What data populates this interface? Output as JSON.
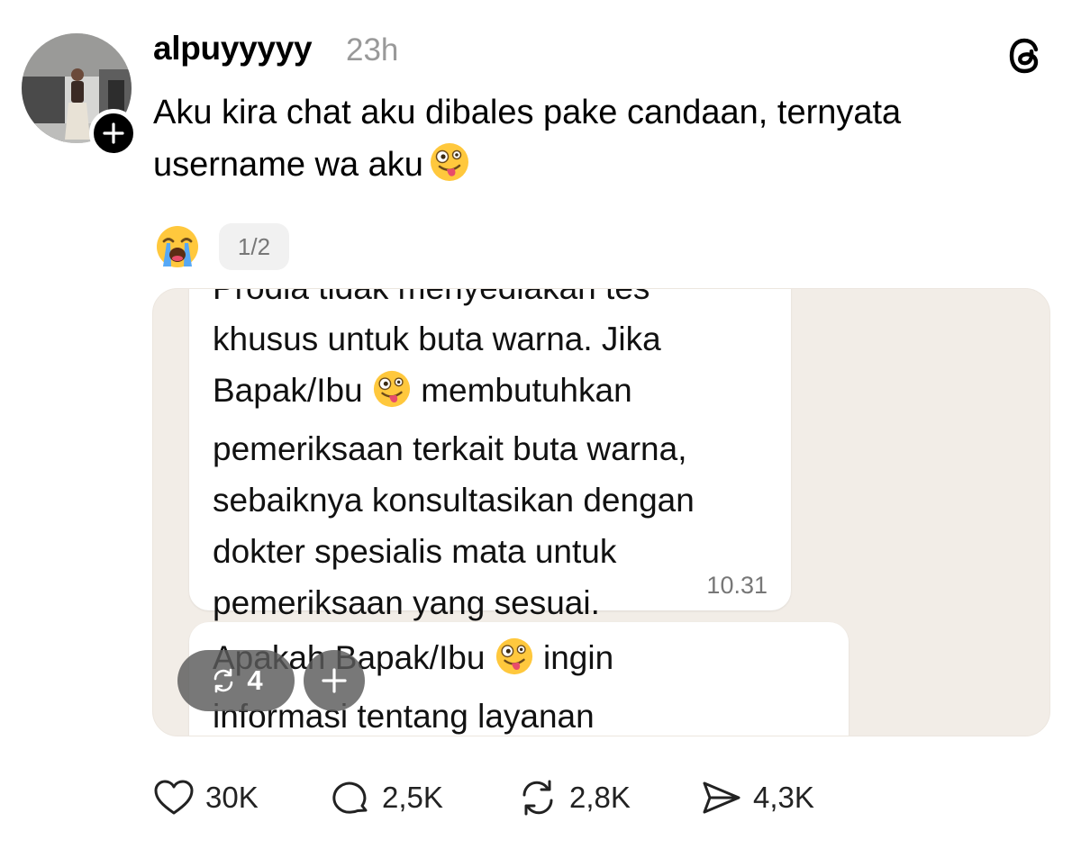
{
  "post": {
    "username": "alpuyyyyy",
    "timestamp": "23h",
    "text": "Aku kira chat aku dibales pake candaan, ternyata username wa aku",
    "text_emoji": "zany-face",
    "reaction_emoji": "loudly-crying-face",
    "image_counter": "1/2"
  },
  "chat": {
    "bubble1": {
      "lines": [
        "Prodia tidak menyediakan tes",
        "khusus untuk buta warna. Jika",
        "Bapak/Ibu",
        "membutuhkan",
        "pemeriksaan terkait buta warna,",
        "sebaiknya konsultasikan dengan",
        "dokter spesialis mata untuk",
        "pemeriksaan yang sesuai."
      ],
      "time": "10.31"
    },
    "bubble2": {
      "lines": [
        "Apakah Bapak/Ibu",
        "ingin",
        "informasi tentang layanan"
      ]
    }
  },
  "overlay": {
    "repost_count": "4"
  },
  "actions": {
    "likes": "30K",
    "replies": "2,5K",
    "reposts": "2,8K",
    "shares": "4,3K"
  },
  "colors": {
    "chat_background": "#f2ede7",
    "bubble": "#ffffff",
    "muted": "#999999",
    "overlay_pill": "#5a5a5a"
  }
}
